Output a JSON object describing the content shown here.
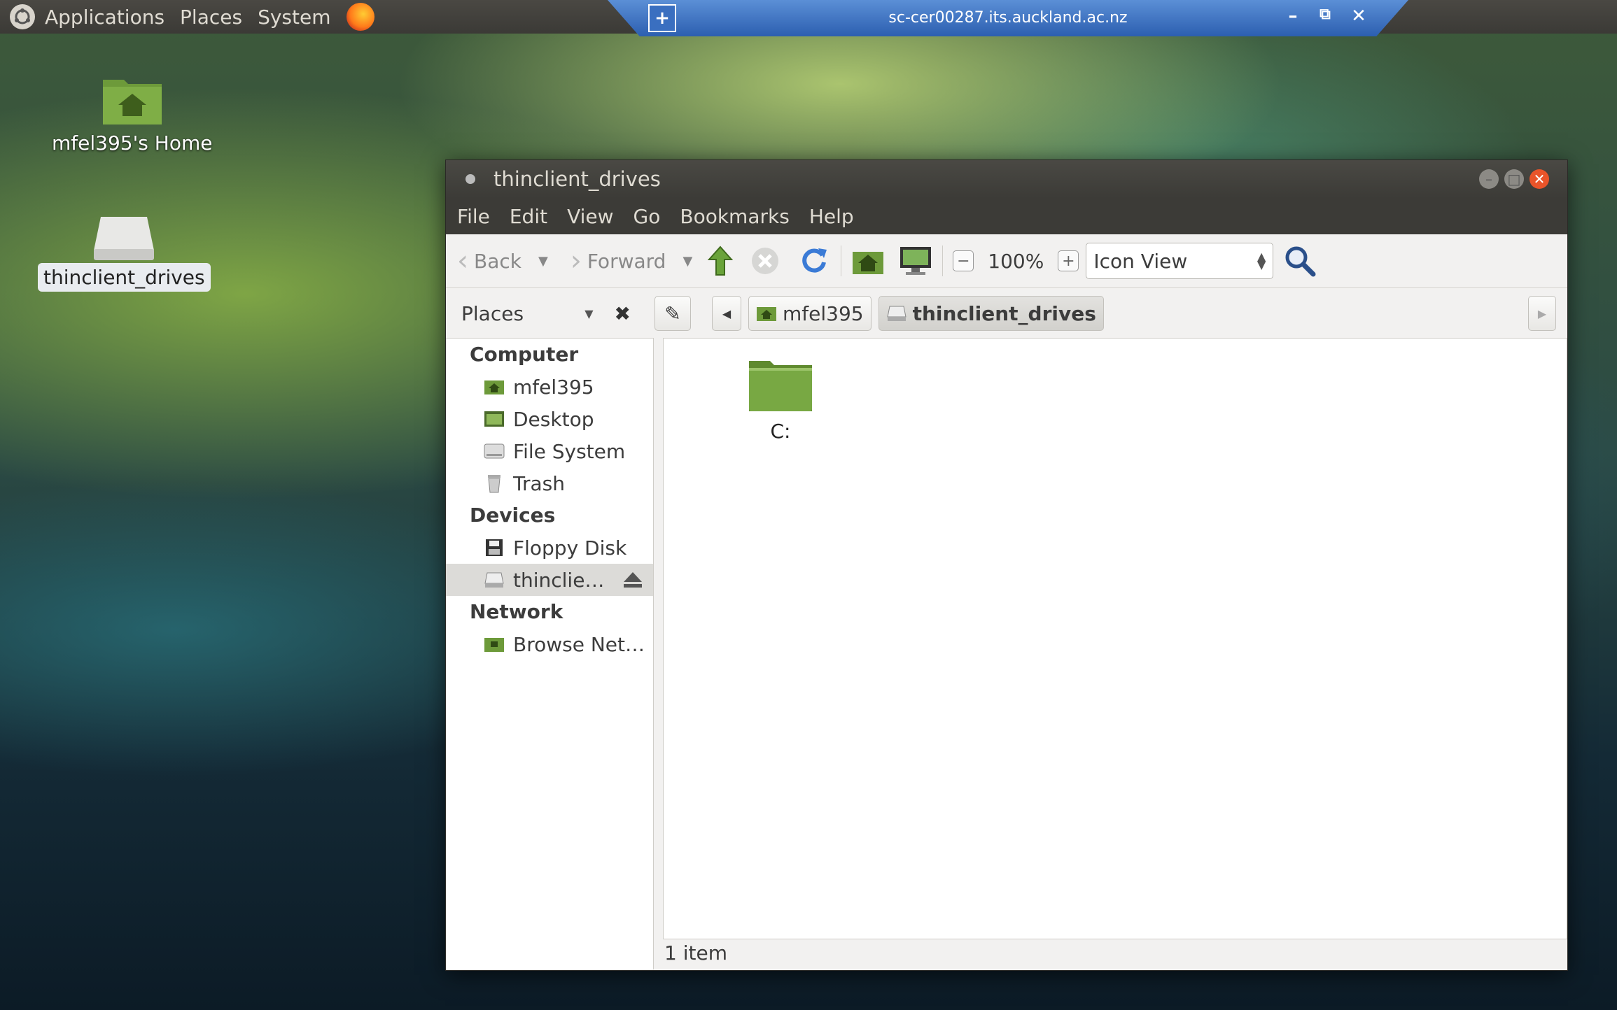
{
  "topbar": {
    "applications": "Applications",
    "places": "Places",
    "system": "System",
    "logo_icon": "ubuntu-logo-icon",
    "browser_icon": "firefox-icon"
  },
  "rdp": {
    "title": "sc-cer00287.its.auckland.ac.nz",
    "pin_icon": "pin-icon",
    "minimize_icon": "minimize-icon",
    "restore_icon": "restore-icon",
    "close_icon": "close-icon"
  },
  "desktop": {
    "home_label": "mfel395's Home",
    "drive_label": "thinclient_drives"
  },
  "window": {
    "title": "thinclient_drives",
    "menu": [
      "File",
      "Edit",
      "View",
      "Go",
      "Bookmarks",
      "Help"
    ],
    "toolbar": {
      "back": "Back",
      "forward": "Forward",
      "zoom": "100%",
      "view_mode": "Icon View"
    },
    "places_label": "Places",
    "breadcrumbs": [
      "mfel395",
      "thinclient_drives"
    ],
    "sidebar": {
      "computer_header": "Computer",
      "computer_items": [
        "mfel395",
        "Desktop",
        "File System",
        "Trash"
      ],
      "devices_header": "Devices",
      "device_items": [
        "Floppy Disk",
        "thinclie…"
      ],
      "network_header": "Network",
      "network_items": [
        "Browse Net…"
      ]
    },
    "files": [
      {
        "name": "C:",
        "icon": "folder-icon"
      }
    ],
    "status": "1 item"
  },
  "colors": {
    "accent_green": "#5f8a2e",
    "topbar_bg": "#3c3b37",
    "rdp_blue": "#2c5fb0",
    "close_orange": "#e9542a"
  }
}
